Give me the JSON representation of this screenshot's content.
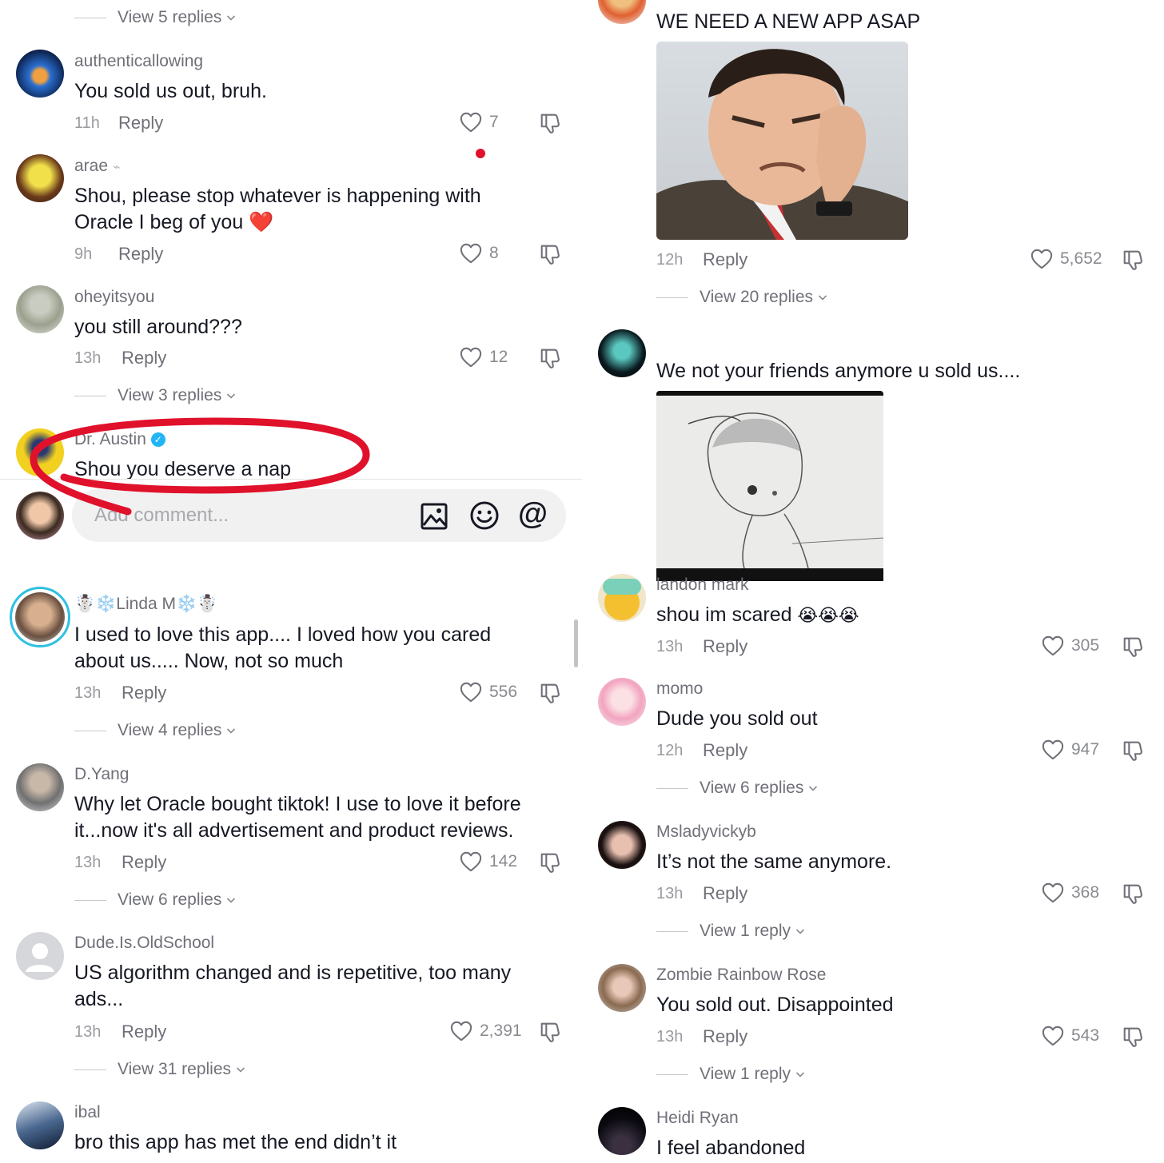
{
  "left": {
    "top_view": "View 5 replies",
    "comments": [
      {
        "user": "authenticallowing",
        "text": "You sold us out, bruh.",
        "time": "11h",
        "reply": "Reply",
        "likes": "7"
      },
      {
        "user": "arae",
        "text_line1": "Shou, please stop whatever is happening with",
        "text_line2": "Oracle I beg of you",
        "text_emoji": "❤️",
        "time": "9h",
        "reply": "Reply",
        "likes": "8"
      },
      {
        "user": "oheyitsyou",
        "text": "you still around???",
        "time": "13h",
        "reply": "Reply",
        "likes": "12",
        "view": "View 3 replies"
      },
      {
        "user": "Dr. Austin",
        "text": "Shou you deserve a nap"
      }
    ],
    "input_placeholder": "Add comment...",
    "comments2": [
      {
        "user": "☃️❄️Linda M❄️☃️",
        "text_line1": "I used to love this app.... I loved how you cared",
        "text_line2": "about us..... Now, not so much",
        "time": "13h",
        "reply": "Reply",
        "likes": "556",
        "view": "View 4 replies"
      },
      {
        "user": "D.Yang",
        "text_line1": "Why let Oracle bought tiktok! I use to love it before",
        "text_line2": "it...now it's all advertisement and product reviews.",
        "time": "13h",
        "reply": "Reply",
        "likes": "142",
        "view": "View 6 replies"
      },
      {
        "user": "Dude.Is.OldSchool",
        "text_line1": "US algorithm changed and is repetitive, too many",
        "text_line2": "ads...",
        "time": "13h",
        "reply": "Reply",
        "likes": "2,391",
        "view": "View 31 replies"
      },
      {
        "user": "ibal",
        "text": "bro this app has met the end didn’t it"
      }
    ]
  },
  "right": {
    "c1": {
      "text": "WE NEED A NEW APP ASAP",
      "time": "12h",
      "reply": "Reply",
      "likes": "5,652",
      "view": "View 20 replies"
    },
    "c2": {
      "text": "We not your friends anymore u sold us...."
    },
    "c3": {
      "user": "landon mark",
      "text": "shou im scared",
      "emojis": "😭😭😭",
      "time": "13h",
      "reply": "Reply",
      "likes": "305"
    },
    "c4": {
      "user": "momo",
      "text": "Dude you sold out",
      "time": "12h",
      "reply": "Reply",
      "likes": "947",
      "view": "View 6 replies"
    },
    "c5": {
      "user": "Msladyvickyb",
      "text": "It’s not the same anymore.",
      "time": "13h",
      "reply": "Reply",
      "likes": "368",
      "view": "View 1 reply"
    },
    "c6": {
      "user": "Zombie Rainbow Rose",
      "text": "You sold out. Disappointed",
      "time": "13h",
      "reply": "Reply",
      "likes": "543",
      "view": "View 1 reply"
    },
    "c7": {
      "user": "Heidi Ryan",
      "text": "I feel abandoned"
    }
  },
  "colors": {
    "annotation": "#e0112b",
    "verified": "#20b5f5",
    "text": "#161823",
    "muted": "#8a8b91"
  }
}
